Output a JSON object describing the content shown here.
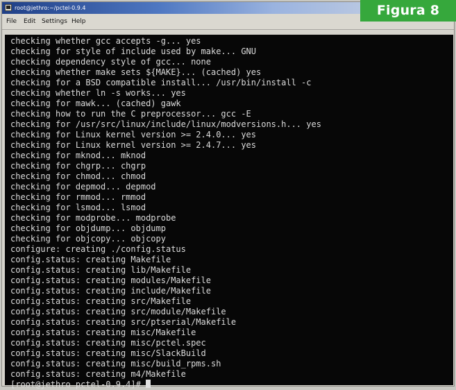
{
  "window": {
    "title": "root@jethro:~/pctel-0.9.4"
  },
  "figure_label": "Figura 8",
  "menu": [
    "File",
    "Edit",
    "Settings",
    "Help"
  ],
  "terminal": {
    "lines": [
      "checking whether gcc accepts -g... yes",
      "checking for style of include used by make... GNU",
      "checking dependency style of gcc... none",
      "checking whether make sets ${MAKE}... (cached) yes",
      "checking for a BSD compatible install... /usr/bin/install -c",
      "checking whether ln -s works... yes",
      "checking for mawk... (cached) gawk",
      "checking how to run the C preprocessor... gcc -E",
      "checking for /usr/src/linux/include/linux/modversions.h... yes",
      "checking for Linux kernel version >= 2.4.0... yes",
      "checking for Linux kernel version >= 2.4.7... yes",
      "checking for mknod... mknod",
      "checking for chgrp... chgrp",
      "checking for chmod... chmod",
      "checking for depmod... depmod",
      "checking for rmmod... rmmod",
      "checking for lsmod... lsmod",
      "checking for modprobe... modprobe",
      "checking for objdump... objdump",
      "checking for objcopy... objcopy",
      "configure: creating ./config.status",
      "config.status: creating Makefile",
      "config.status: creating lib/Makefile",
      "config.status: creating modules/Makefile",
      "config.status: creating include/Makefile",
      "config.status: creating src/Makefile",
      "config.status: creating src/module/Makefile",
      "config.status: creating src/ptserial/Makefile",
      "config.status: creating misc/Makefile",
      "config.status: creating misc/pctel.spec",
      "config.status: creating misc/SlackBuild",
      "config.status: creating misc/build_rpms.sh",
      "config.status: creating m4/Makefile"
    ],
    "prompt": "[root@jethro pctel-0.9.4]# "
  }
}
